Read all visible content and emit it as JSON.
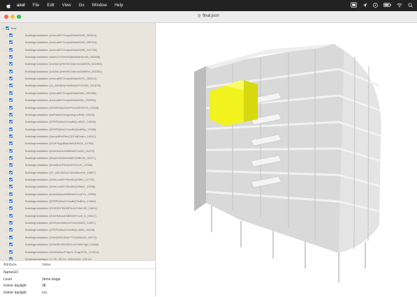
{
  "menubar": {
    "app_name": "azul",
    "items": [
      "File",
      "Edit",
      "View",
      "Go",
      "Window",
      "Help"
    ]
  },
  "window": {
    "title": "final.json"
  },
  "tree": {
    "root_label": "final",
    "items": [
      "BuildingInstallation {1rtxLa69TOvvpmMhaHW45_252844}",
      "BuildingInstallation {1rtxLa69TOvvpmMhaHW45_256754}",
      "BuildingInstallation {1rtxLa69TOvvpmMhaHW0B_261708}",
      "BuildingInstallation {3a8t12YHYk9ZQbkN8NHaV45_252838}",
      "BuildingInstallation {1vD5xCyHeS9X24amm2A69Mn_252350}",
      "BuildingInstallation {1vD5xCyHeS9X24amm2A69Mn_252351}",
      "BuildingInstallation {1rtxLa69TOvvpmMhaHW7h_252522}",
      "BuildingInstallation {1x_A0DM4yTxN9AQzHYbO0D_251878}",
      "BuildingInstallation {1rtxLa69TOvvpmMhaHWkx_255788}",
      "BuildingInstallation {1rtxLa69TOvvpmMhaHWfu_252663}",
      "BuildingInstallation {2KNR90qcODnPGsrUNVSD7k_12828}",
      "BuildingInstallation {0aPx6a2bOUgoeKqmcRbB_22335}",
      "BuildingInstallation {2PRP3A3aLVVuxfbQLoBXG_16226}",
      "BuildingInstallation {2PRP3A3aLVVuxfbQ4odBks_17668}",
      "BuildingInstallation {2anqzB9cF9bkQS1YqEtmpo_14047}",
      "BuildingInstallation {0DxPVqg4BlwuNKOHBOh_10708}",
      "BuildingInstallation {2UeHtcbwvEMBN4HYcsK0_20479}",
      "BuildingInstallation {0myHnDU8MHbi6FU5BEO4_30471}",
      "BuildingInstallation {2La6SnGF0bfuSPSXXVE_17080}",
      "BuildingInstallation {2V_sWL2k2Ua7d2mBuenYe_16887}",
      "BuildingInstallation {1Nr4Lco9I5Y9bsSIQrD5bC_1177B}",
      "BuildingInstallation {1Nr4Lco9I5Y9bsSIQrD5bbZ_13288}",
      "BuildingInstallation {2UeHtcbwvEMBN4HYcsKYu_19535}",
      "BuildingInstallation {2PRP3A3aLVVuxfbQ7loBXu_17669}",
      "BuildingInstallation {3Y6SR97BH3ETevUO4bKOE_21801}",
      "BuildingInstallation {2UeHtcbwvEMBN4HYcsK_K_20817}",
      "BuildingInstallation {0H2Noxr5r84vmYfcsHxNM1_22807}",
      "BuildingInstallation {2PRP3A3aLVVuxfbQLoM0t_18158}",
      "BuildingInstallation {21fbd22B14EuF7TOAB5xG8_42972}",
      "BuildingInstallation {3Y6SR97BH3ETevUO4bKOgS_21888}",
      "BuildingInstallation {2nvtEu8wnFTaw7LJTugnFOK_174010}",
      "BuildingInstallation {3_ZE_2K7L1_DNmvG31_ZeF12}"
    ]
  },
  "attributes": {
    "col_attribute": "Attribute",
    "col_value": "Value",
    "rows": [
      {
        "key": "NameGO",
        "value": ""
      },
      {
        "key": "Level",
        "value": "3ème étage"
      },
      {
        "key": "Indoor daylight",
        "value": "98"
      },
      {
        "key": "Indoor daylight",
        "value": "ccc"
      }
    ]
  },
  "viewer": {
    "highlight_color": "#f2f21f",
    "building_color": "#d6d6d6"
  }
}
